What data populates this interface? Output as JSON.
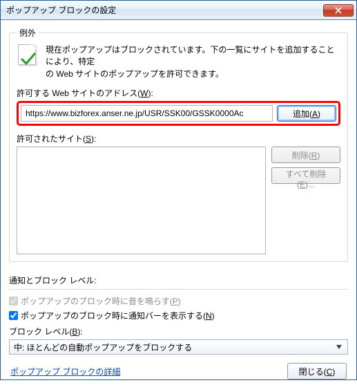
{
  "titlebar": {
    "title": "ポップアップ ブロックの設定"
  },
  "exceptions": {
    "legend": "例外",
    "intro_line1": "現在ポップアップはブロックされています。下の一覧にサイトを追加することにより、特定",
    "intro_line2": "の Web サイトのポップアップを許可できます。",
    "address_label_pre": "許可する Web サイトのアドレス(",
    "address_label_key": "W",
    "address_label_post": "):",
    "address_value": "https://www.bizforex.anser.ne.jp/USR/SSK00/GSSK0000Ac",
    "add_btn_pre": "追加(",
    "add_btn_key": "A",
    "add_btn_post": ")",
    "allowed_label_pre": "許可されたサイト(",
    "allowed_label_key": "S",
    "allowed_label_post": "):",
    "remove_btn_pre": "削除(",
    "remove_btn_key": "R",
    "remove_btn_post": ")",
    "remove_all_pre": "すべて削除(",
    "remove_all_key": "E",
    "remove_all_post": ")..."
  },
  "notify": {
    "heading": "通知とブロック レベル:",
    "sound_pre": "ポップアップのブロック時に音を鳴らす(",
    "sound_key": "P",
    "sound_post": ")",
    "bar_pre": "ポップアップのブロック時に通知バーを表示する(",
    "bar_key": "N",
    "bar_post": ")",
    "level_label_pre": "ブロック レベル(",
    "level_label_key": "B",
    "level_label_post": "):",
    "level_value": "中: ほとんどの自動ポップアップをブロックする"
  },
  "footer": {
    "link": "ポップアップ ブロックの詳細",
    "close_pre": "閉じる(",
    "close_key": "C",
    "close_post": ")"
  }
}
